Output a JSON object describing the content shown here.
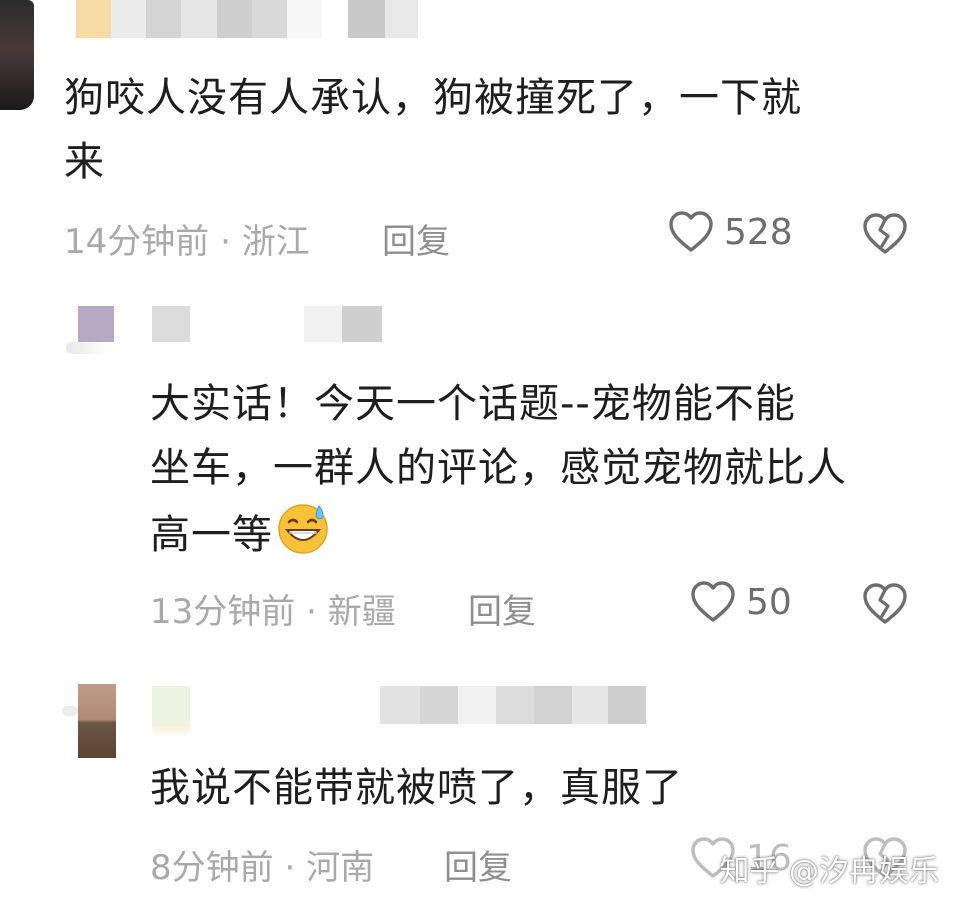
{
  "comments": [
    {
      "text_line1": "狗咬人没有人承认，狗被撞死了，一下就",
      "text_line2": "来",
      "time": "14分钟前",
      "location": "浙江",
      "reply_label": "回复",
      "likes": "528"
    },
    {
      "text_line1": "大实话！今天一个话题--宠物能不能",
      "text_line2": "坐车，一群人的评论，感觉宠物就比人",
      "text_line3": "高一等",
      "time": "13分钟前",
      "location": "新疆",
      "reply_label": "回复",
      "likes": "50"
    },
    {
      "text_line1": "我说不能带就被喷了，真服了",
      "time": "8分钟前",
      "location": "河南",
      "reply_label": "回复",
      "likes": "16"
    }
  ],
  "separator": "·",
  "watermark": "知乎 @汐冉娱乐",
  "icons": {
    "like": "heart-outline-icon",
    "dislike": "broken-heart-icon",
    "emoji": "grinning-sweat-emoji"
  },
  "colors": {
    "text": "#1e1e1e",
    "meta": "#a9a9a9",
    "icon": "#6e6e6e"
  }
}
